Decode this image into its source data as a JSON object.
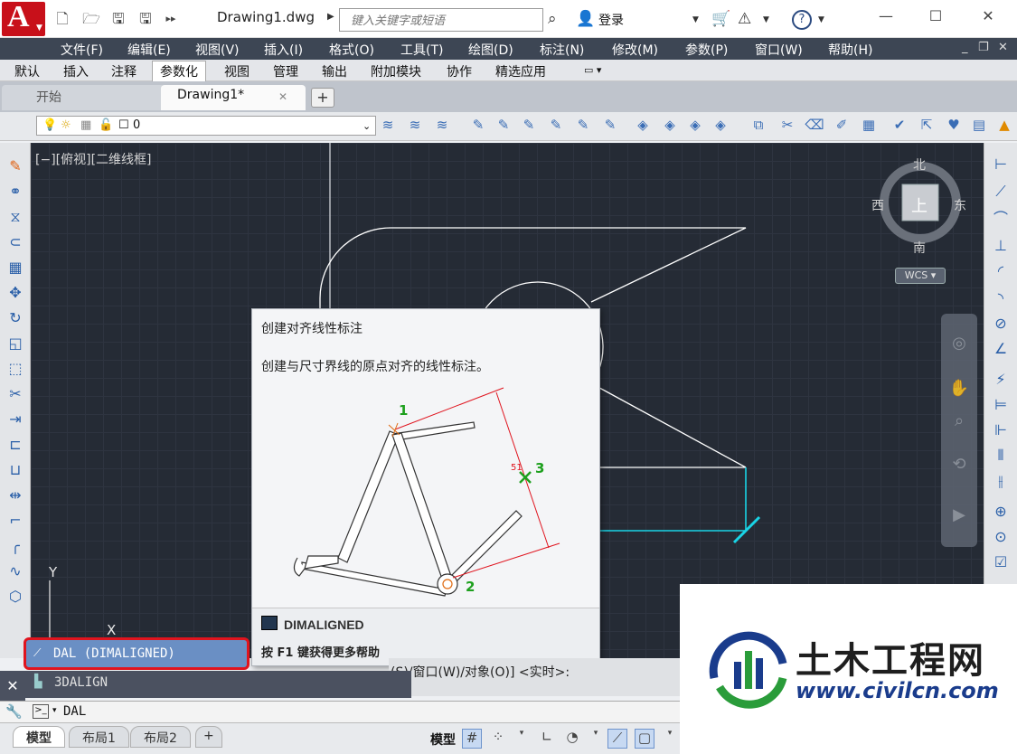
{
  "window": {
    "doc_title": "Drawing1.dwg",
    "search_placeholder": "键入关键字或短语",
    "login": "登录"
  },
  "menu": [
    "文件(F)",
    "编辑(E)",
    "视图(V)",
    "插入(I)",
    "格式(O)",
    "工具(T)",
    "绘图(D)",
    "标注(N)",
    "修改(M)",
    "参数(P)",
    "窗口(W)",
    "帮助(H)"
  ],
  "ribbon_tabs": [
    "默认",
    "插入",
    "注释",
    "参数化",
    "视图",
    "管理",
    "输出",
    "附加模块",
    "协作",
    "精选应用"
  ],
  "ribbon_active": "参数化",
  "doc_tabs": {
    "start": "开始",
    "drawing": "Drawing1*"
  },
  "layer": {
    "name": "0"
  },
  "viewport": {
    "label": "[−][俯视][二维线框]"
  },
  "viewcube": {
    "north": "北",
    "south": "南",
    "east": "东",
    "west": "西",
    "top": "上",
    "wcs": "WCS"
  },
  "ucs": {
    "y": "Y",
    "x": "X"
  },
  "tooltip": {
    "title": "创建对齐线性标注",
    "description": "创建与尺寸界线的原点对齐的线性标注。",
    "p1": "1",
    "p2": "2",
    "p3": "3",
    "dim_text": "51",
    "command": "DIMALIGNED",
    "help": "按 F1 键获得更多帮助"
  },
  "autocomplete": [
    "DAL (DIMALIGNED)",
    "3DALIGN"
  ],
  "command_history": "(S)/窗口(W)/对象(O)] <实时>:",
  "command_input": "DAL",
  "layout_tabs": [
    "模型",
    "布局1",
    "布局2"
  ],
  "status": {
    "model": "模型"
  },
  "watermark": {
    "brand": "土木工程网",
    "url": "www.civilcn.com"
  },
  "colors": {
    "menubar": "#3d4654",
    "canvas": "#252b35",
    "app_red": "#c8101a",
    "highlight": "#e0141e",
    "cyan": "#19d4e6"
  }
}
